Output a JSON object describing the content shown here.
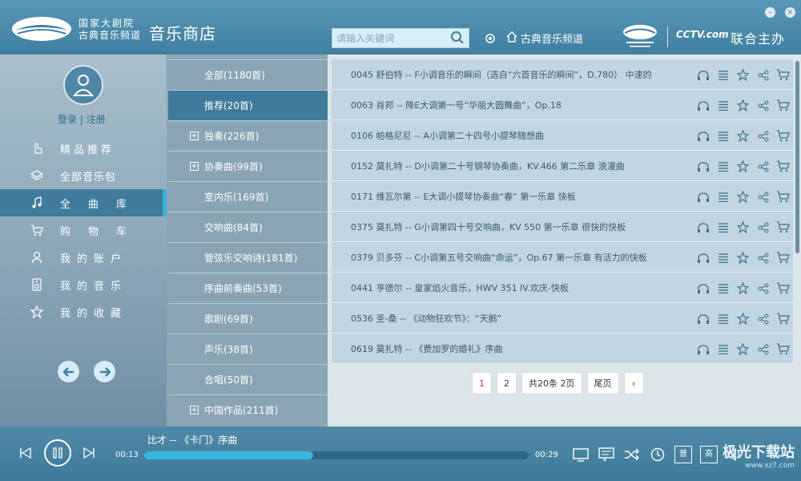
{
  "header": {
    "brand_line1": "国家大剧院",
    "brand_line2": "古典音乐频道",
    "store_title": "音乐商店",
    "search_placeholder": "请输入关键词",
    "channel_label": "古典音乐频道",
    "cctv_label": "CCTV.com",
    "joint_label": "联合主办"
  },
  "sidebar": {
    "login": "登录",
    "separator": "|",
    "register": "注册",
    "items": [
      {
        "label": "精品推荐",
        "icon": "hand-pointer-icon"
      },
      {
        "label": "全部音乐包",
        "icon": "layers-icon"
      },
      {
        "label": "全曲库",
        "icon": "music-note-icon"
      },
      {
        "label": "购物车",
        "icon": "cart-icon"
      },
      {
        "label": "我的账户",
        "icon": "user-icon"
      },
      {
        "label": "我的音乐",
        "icon": "speaker-icon"
      },
      {
        "label": "我的收藏",
        "icon": "star-icon"
      }
    ],
    "active_index": 2
  },
  "categories": [
    {
      "label": "全部(1180首)",
      "expandable": false
    },
    {
      "label": "推荐(20首)",
      "expandable": false
    },
    {
      "label": "独奏(226首)",
      "expandable": true
    },
    {
      "label": "协奏曲(99首)",
      "expandable": true
    },
    {
      "label": "室内乐(169首)",
      "expandable": false
    },
    {
      "label": "交响曲(84首)",
      "expandable": false
    },
    {
      "label": "管弦乐交响诗(181首)",
      "expandable": false
    },
    {
      "label": "序曲前奏曲(53首)",
      "expandable": false
    },
    {
      "label": "歌剧(69首)",
      "expandable": false
    },
    {
      "label": "声乐(38首)",
      "expandable": false
    },
    {
      "label": "合唱(50首)",
      "expandable": false
    },
    {
      "label": "中国作品(211首)",
      "expandable": true
    }
  ],
  "categories_active_index": 1,
  "songs": [
    {
      "title": "0045 舒伯特 -- F小调音乐的瞬间（选自“六首音乐的瞬间”，D.780） 中速的"
    },
    {
      "title": "0063 肖邦 -- 降E大调第一号“华丽大圆舞曲”，Op.18"
    },
    {
      "title": "0106 帕格尼尼 -- A小调第二十四号小提琴随想曲"
    },
    {
      "title": "0152 莫扎特 -- D小调第二十号钢琴协奏曲，KV.466 第二乐章 浪漫曲"
    },
    {
      "title": "0171 维瓦尔第 -- E大调小提琴协奏曲“春” 第一乐章 快板"
    },
    {
      "title": "0375 莫扎特 -- G小调第四十号交响曲，KV 550 第一乐章 很快的快板"
    },
    {
      "title": "0379 贝多芬 -- C小调第五号交响曲“命运”，Op.67 第一乐章 有活力的快板"
    },
    {
      "title": "0441 亨德尔 -- 皇家焰火音乐，HWV 351 IV.欢庆-快板"
    },
    {
      "title": "0536 圣-桑 -- 《动物狂欢节》：“天鹅”"
    },
    {
      "title": "0619 莫扎特 -- 《费加罗的婚礼》序曲"
    }
  ],
  "pager": {
    "page1": "1",
    "page2": "2",
    "summary": "共20条 2页",
    "last": "尾页",
    "next": "›"
  },
  "player": {
    "now_playing": "比才 -- 《卡门》序曲",
    "current_time": "00:13",
    "total_time": "00:29",
    "progress": 0.44,
    "quality_label1": "普",
    "quality_label2": "高"
  },
  "watermark": {
    "main": "极光下载站",
    "sub": "www.xz7.com"
  }
}
